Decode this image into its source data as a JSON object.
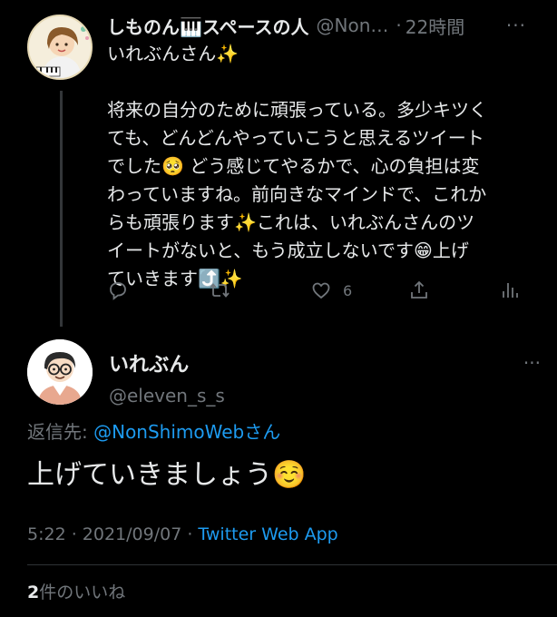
{
  "parent": {
    "display_name": "しものん🎹スペースの人",
    "handle": "@Non…",
    "separator": "·",
    "time": "22時間",
    "more": "···",
    "text": "いれぶんさん✨\n\n将来の自分のために頑張っている。多少キツく\nても、どんどんやっていこうと思えるツイート\nでした🥺 どう感じてやるかで、心の負担は変\nわっていますね。前向きなマインドで、これか\nらも頑張ります✨これは、いれぶんさんのツ\nイートがないと、もう成立しないです😁上げ\nていきます⤴️✨",
    "actions": {
      "reply_icon": "reply-icon",
      "retweet_icon": "retweet-icon",
      "like_icon": "heart-icon",
      "like_count": "6",
      "share_icon": "share-icon",
      "stats_icon": "analytics-icon"
    }
  },
  "reply": {
    "display_name": "いれぶん",
    "handle": "@eleven_s_s",
    "more": "···",
    "reply_to_prefix": "返信先: ",
    "reply_to_mention": "@NonShimoWebさん",
    "text": "上げていきましょう☺️",
    "timestamp": "5:22 · 2021/09/07 · ",
    "source": "Twitter Web App",
    "like_count": "2",
    "like_suffix": "件のいいね"
  },
  "colors": {
    "background": "#000000",
    "text": "#e7e9ea",
    "secondary": "#71767b",
    "accent": "#1d9bf0"
  }
}
